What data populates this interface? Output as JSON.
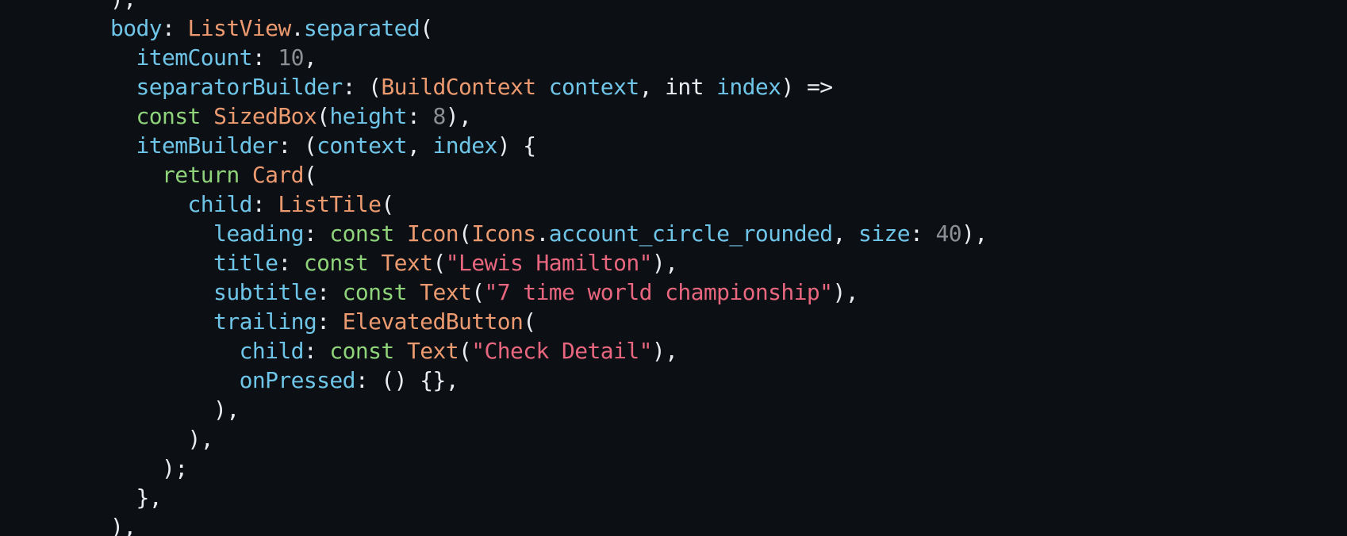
{
  "theme": {
    "background": "#0c0f14",
    "property_color": "#6fc5e8",
    "type_color": "#ec9a6f",
    "keyword_color": "#8fd37a",
    "number_color": "#8c8f94",
    "string_color": "#e8677f",
    "punctuation_color": "#e9edf2"
  },
  "code": {
    "lines": [
      [
        {
          "t": "),",
          "k": "punc"
        }
      ],
      [
        {
          "t": "body",
          "k": "prop"
        },
        {
          "t": ": ",
          "k": "punc"
        },
        {
          "t": "ListView",
          "k": "type"
        },
        {
          "t": ".",
          "k": "punc"
        },
        {
          "t": "separated",
          "k": "prop"
        },
        {
          "t": "(",
          "k": "punc"
        }
      ],
      [
        {
          "t": "  itemCount",
          "k": "prop"
        },
        {
          "t": ": ",
          "k": "punc"
        },
        {
          "t": "10",
          "k": "num"
        },
        {
          "t": ",",
          "k": "punc"
        }
      ],
      [
        {
          "t": "  separatorBuilder",
          "k": "prop"
        },
        {
          "t": ": (",
          "k": "punc"
        },
        {
          "t": "BuildContext",
          "k": "type"
        },
        {
          "t": " ",
          "k": "punc"
        },
        {
          "t": "context",
          "k": "prop"
        },
        {
          "t": ", int ",
          "k": "plain"
        },
        {
          "t": "index",
          "k": "prop"
        },
        {
          "t": ") =>",
          "k": "punc"
        }
      ],
      [
        {
          "t": "  const ",
          "k": "kw"
        },
        {
          "t": "SizedBox",
          "k": "type"
        },
        {
          "t": "(",
          "k": "punc"
        },
        {
          "t": "height",
          "k": "prop"
        },
        {
          "t": ": ",
          "k": "punc"
        },
        {
          "t": "8",
          "k": "num"
        },
        {
          "t": "),",
          "k": "punc"
        }
      ],
      [
        {
          "t": "  itemBuilder",
          "k": "prop"
        },
        {
          "t": ": (",
          "k": "punc"
        },
        {
          "t": "context",
          "k": "prop"
        },
        {
          "t": ", ",
          "k": "punc"
        },
        {
          "t": "index",
          "k": "prop"
        },
        {
          "t": ") {",
          "k": "punc"
        }
      ],
      [
        {
          "t": "    return ",
          "k": "kw"
        },
        {
          "t": "Card",
          "k": "type"
        },
        {
          "t": "(",
          "k": "punc"
        }
      ],
      [
        {
          "t": "      child",
          "k": "prop"
        },
        {
          "t": ": ",
          "k": "punc"
        },
        {
          "t": "ListTile",
          "k": "type"
        },
        {
          "t": "(",
          "k": "punc"
        }
      ],
      [
        {
          "t": "        leading",
          "k": "prop"
        },
        {
          "t": ": ",
          "k": "punc"
        },
        {
          "t": "const ",
          "k": "kw"
        },
        {
          "t": "Icon",
          "k": "type"
        },
        {
          "t": "(",
          "k": "punc"
        },
        {
          "t": "Icons",
          "k": "type"
        },
        {
          "t": ".",
          "k": "punc"
        },
        {
          "t": "account_circle_rounded",
          "k": "prop"
        },
        {
          "t": ", ",
          "k": "punc"
        },
        {
          "t": "size",
          "k": "prop"
        },
        {
          "t": ": ",
          "k": "punc"
        },
        {
          "t": "40",
          "k": "num"
        },
        {
          "t": "),",
          "k": "punc"
        }
      ],
      [
        {
          "t": "        title",
          "k": "prop"
        },
        {
          "t": ": ",
          "k": "punc"
        },
        {
          "t": "const ",
          "k": "kw"
        },
        {
          "t": "Text",
          "k": "type"
        },
        {
          "t": "(",
          "k": "punc"
        },
        {
          "t": "\"Lewis Hamilton\"",
          "k": "str"
        },
        {
          "t": "),",
          "k": "punc"
        }
      ],
      [
        {
          "t": "        subtitle",
          "k": "prop"
        },
        {
          "t": ": ",
          "k": "punc"
        },
        {
          "t": "const ",
          "k": "kw"
        },
        {
          "t": "Text",
          "k": "type"
        },
        {
          "t": "(",
          "k": "punc"
        },
        {
          "t": "\"7 time world championship\"",
          "k": "str"
        },
        {
          "t": "),",
          "k": "punc"
        }
      ],
      [
        {
          "t": "        trailing",
          "k": "prop"
        },
        {
          "t": ": ",
          "k": "punc"
        },
        {
          "t": "ElevatedButton",
          "k": "type"
        },
        {
          "t": "(",
          "k": "punc"
        }
      ],
      [
        {
          "t": "          child",
          "k": "prop"
        },
        {
          "t": ": ",
          "k": "punc"
        },
        {
          "t": "const ",
          "k": "kw"
        },
        {
          "t": "Text",
          "k": "type"
        },
        {
          "t": "(",
          "k": "punc"
        },
        {
          "t": "\"Check Detail\"",
          "k": "str"
        },
        {
          "t": "),",
          "k": "punc"
        }
      ],
      [
        {
          "t": "          onPressed",
          "k": "prop"
        },
        {
          "t": ": () {},",
          "k": "punc"
        }
      ],
      [
        {
          "t": "        ),",
          "k": "punc"
        }
      ],
      [
        {
          "t": "      ),",
          "k": "punc"
        }
      ],
      [
        {
          "t": "    );",
          "k": "punc"
        }
      ],
      [
        {
          "t": "  },",
          "k": "punc"
        }
      ],
      [
        {
          "t": "),",
          "k": "punc"
        }
      ]
    ]
  }
}
